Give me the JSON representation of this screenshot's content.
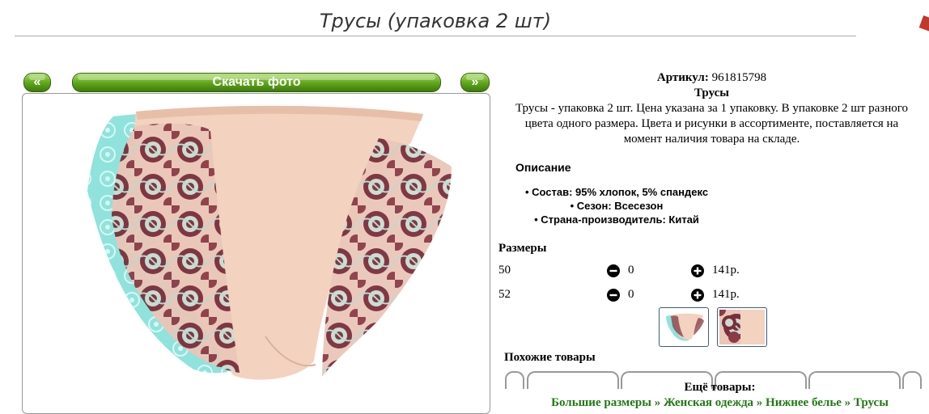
{
  "product": {
    "title": "Трусы (упаковка 2 шт)",
    "article_label": "Артикул:",
    "article_value": "961815798",
    "name": "Трусы",
    "summary_1": "Трусы - упаковка 2 шт. Цена указана за 1 упаковку. В упаковке 2 шт разного",
    "summary_2": "цвета одного размера. Цвета и рисунки в ассортименте, поставляется на",
    "summary_3": "момент наличия товара на складе."
  },
  "gallery": {
    "prev_label": "«",
    "download_label": "Скачать фото",
    "next_label": "»"
  },
  "description": {
    "heading": "Описание",
    "items": [
      "Состав: 95% хлопок, 5% спандекс",
      "Сезон: Всесезон",
      "Страна-производитель: Китай"
    ]
  },
  "sizes": {
    "heading": "Размеры",
    "rows": [
      {
        "size": "50",
        "qty": "0",
        "price": "141р."
      },
      {
        "size": "52",
        "qty": "0",
        "price": "141р."
      }
    ]
  },
  "similar": {
    "heading": "Похожие товары"
  },
  "more": {
    "heading": "Ещё товары:",
    "breadcrumbs": [
      "Большие размеры",
      "Женская одежда",
      "Нижнее белье",
      "Трусы"
    ],
    "separator": "»"
  },
  "colors": {
    "accent_green": "#5ea51b",
    "link_green": "#1f7a12",
    "fabric_peach": "#f3d2bf",
    "fabric_mint": "#8fe3dc",
    "lace_burgundy": "#7a2e3a"
  },
  "icons": [
    "minus-circle-icon",
    "plus-circle-icon",
    "corner-icon"
  ]
}
